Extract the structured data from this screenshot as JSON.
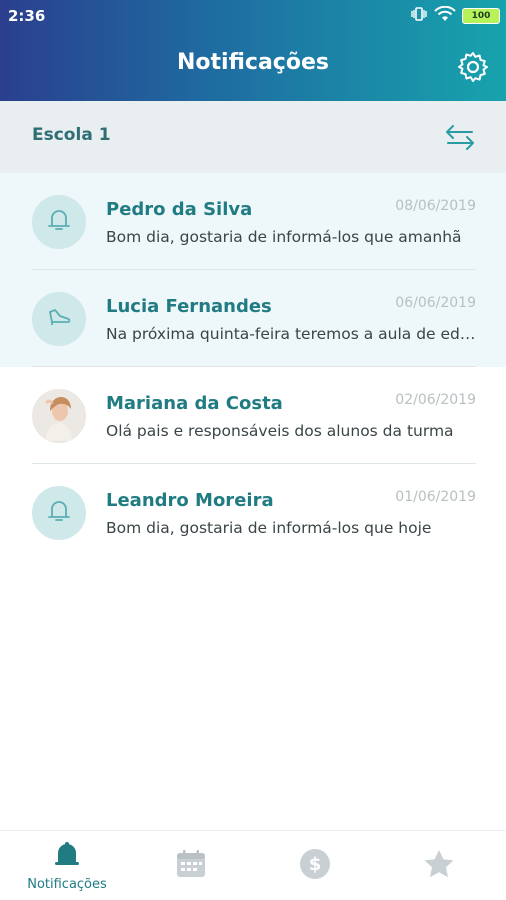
{
  "status_bar": {
    "time": "2:36",
    "battery": "100"
  },
  "header": {
    "title": "Notificações"
  },
  "school": {
    "name": "Escola 1"
  },
  "notifications": [
    {
      "name": "Pedro da Silva",
      "date": "08/06/2019",
      "message": "Bom dia, gostaria de informá-los que amanhã",
      "avatar_icon": "bell-outline-icon",
      "unread": true
    },
    {
      "name": "Lucia Fernandes",
      "date": "06/06/2019",
      "message": "Na próxima quinta-feira teremos a aula de educação",
      "avatar_icon": "shoe-icon",
      "unread": true
    },
    {
      "name": "Mariana da Costa",
      "date": "02/06/2019",
      "message": "Olá pais e responsáveis dos alunos da turma",
      "avatar_icon": "user-photo",
      "unread": false
    },
    {
      "name": "Leandro Moreira",
      "date": "01/06/2019",
      "message": "Bom dia, gostaria de informá-los que hoje",
      "avatar_icon": "bell-outline-icon",
      "unread": false
    }
  ],
  "bottom_nav": {
    "tabs": [
      {
        "label": "Notificações",
        "icon": "bell-icon",
        "active": true
      },
      {
        "label": "",
        "icon": "calendar-icon",
        "active": false
      },
      {
        "label": "",
        "icon": "dollar-icon",
        "active": false
      },
      {
        "label": "",
        "icon": "star-icon",
        "active": false
      }
    ]
  },
  "colors": {
    "accent": "#207c82",
    "header_start": "#2b3f8e",
    "header_end": "#17a3ad",
    "inactive_icon": "#c9d0d3"
  }
}
